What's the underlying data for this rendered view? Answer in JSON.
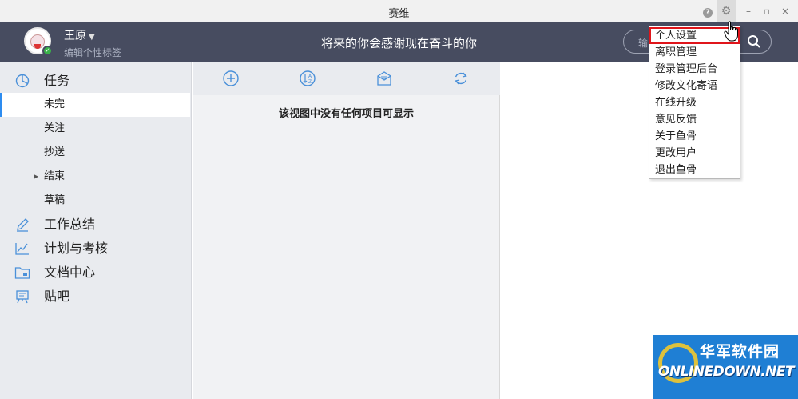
{
  "window": {
    "title": "赛维",
    "help_icon": "question-icon",
    "settings_icon": "gear-icon"
  },
  "header": {
    "username": "王原",
    "signature": "编辑个性标签",
    "motto": "将来的你会感谢现在奋斗的你",
    "search_placeholder": "输"
  },
  "sidebar": {
    "tasks": {
      "label": "任务",
      "icon": "pie-chart-icon"
    },
    "task_items": [
      {
        "label": "未完"
      },
      {
        "label": "关注"
      },
      {
        "label": "抄送"
      },
      {
        "label": "结束"
      },
      {
        "label": "草稿"
      }
    ],
    "sections": [
      {
        "label": "工作总结",
        "icon": "pencil-icon"
      },
      {
        "label": "计划与考核",
        "icon": "line-chart-icon"
      },
      {
        "label": "文档中心",
        "icon": "folder-icon"
      },
      {
        "label": "贴吧",
        "icon": "board-icon"
      }
    ]
  },
  "toolbar": {
    "icons": [
      "add-icon",
      "sort-icon",
      "mail-icon",
      "refresh-icon"
    ]
  },
  "content": {
    "empty_message": "该视图中没有任何项目可显示"
  },
  "menu": {
    "items": [
      {
        "label": "个人设置"
      },
      {
        "label": "离职管理"
      },
      {
        "label": "登录管理后台"
      },
      {
        "label": "修改文化寄语"
      },
      {
        "label": "在线升级"
      },
      {
        "label": "意见反馈"
      },
      {
        "label": "关于鱼骨"
      },
      {
        "label": "更改用户"
      },
      {
        "label": "退出鱼骨"
      }
    ]
  },
  "watermark": {
    "cn": "华军软件园",
    "en": "ONLINEDOWN.NET"
  },
  "colors": {
    "header_bg": "#474c60",
    "sidebar_bg": "#e9ebef",
    "active_accent": "#2d8cf0",
    "highlight_border": "#e0151b",
    "icon_blue": "#4a90d9"
  }
}
